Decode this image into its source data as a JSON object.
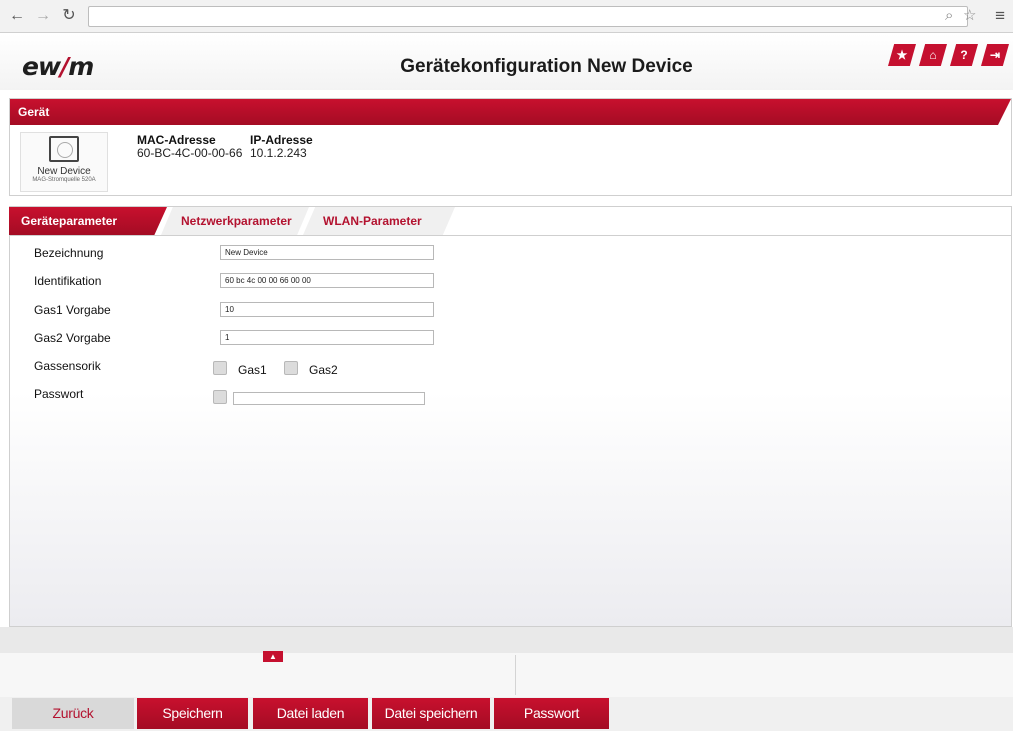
{
  "browser": {
    "back_icon": "arrow-left",
    "forward_icon": "arrow-right",
    "reload_icon": "reload",
    "address_value": ""
  },
  "header": {
    "logo_text_left": "ew",
    "logo_text_slash": "/",
    "logo_text_right": "m",
    "title": "Gerätekonfiguration New Device",
    "icons": [
      "star-icon",
      "home-icon",
      "help-icon",
      "logout-icon"
    ],
    "icon_glyphs": [
      "★",
      "⌂",
      "?",
      "⇥"
    ]
  },
  "device": {
    "section_title": "Gerät",
    "card_name": "New Device",
    "card_type": "MAG-Stromquelle 520A",
    "mac_label": "MAC-Adresse",
    "mac_value": "60-BC-4C-00-00-66",
    "ip_label": "IP-Adresse",
    "ip_value": "10.1.2.243"
  },
  "tabs": [
    {
      "label": "Geräteparameter",
      "active": true
    },
    {
      "label": "Netzwerkparameter",
      "active": false
    },
    {
      "label": "WLAN-Parameter",
      "active": false
    }
  ],
  "form": {
    "bezeichnung_label": "Bezeichnung",
    "bezeichnung_value": "New Device",
    "identifikation_label": "Identifikation",
    "identifikation_value": "60 bc 4c 00 00 66 00 00",
    "gas1_label": "Gas1 Vorgabe",
    "gas1_value": "10",
    "gas2_label": "Gas2 Vorgabe",
    "gas2_value": "1",
    "gassensorik_label": "Gassensorik",
    "gassensorik_opt1": "Gas1",
    "gassensorik_opt2": "Gas2",
    "passwort_label": "Passwort",
    "passwort_value": ""
  },
  "footer": {
    "buttons": [
      "Zurück",
      "Speichern",
      "Datei laden",
      "Datei speichern",
      "Passwort"
    ]
  },
  "colors": {
    "accent": "#c5102f",
    "accent_dark": "#a40c24"
  }
}
